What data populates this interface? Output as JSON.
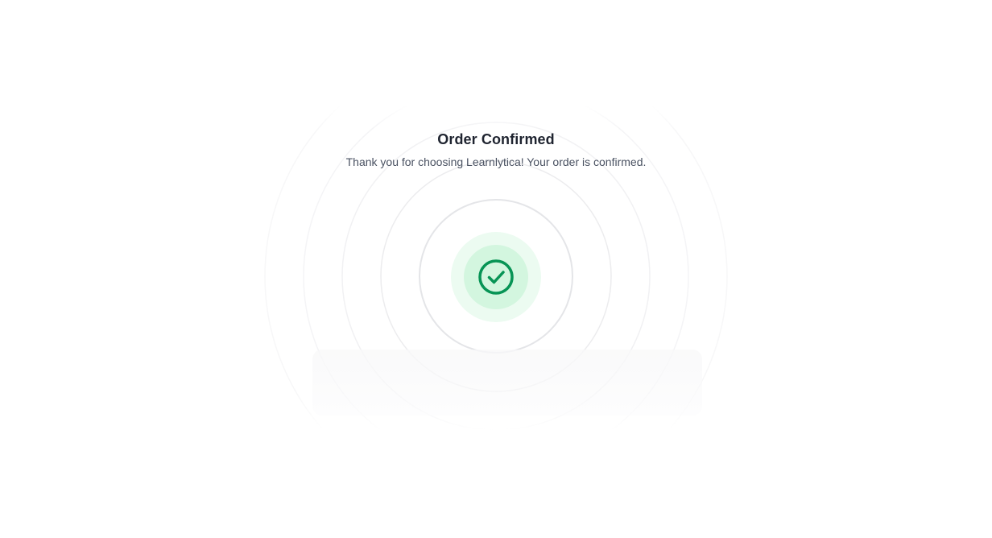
{
  "confirmation": {
    "title": "Order Confirmed",
    "message": "Thank you for choosing Learnlytica! Your order is confirmed.",
    "status_icon": "check-circle-icon"
  },
  "colors": {
    "success": "#079455",
    "success_light": "#d3f6df",
    "success_lighter": "#ecfbf1",
    "heading": "#1f2430",
    "body_text": "#4a5262"
  }
}
